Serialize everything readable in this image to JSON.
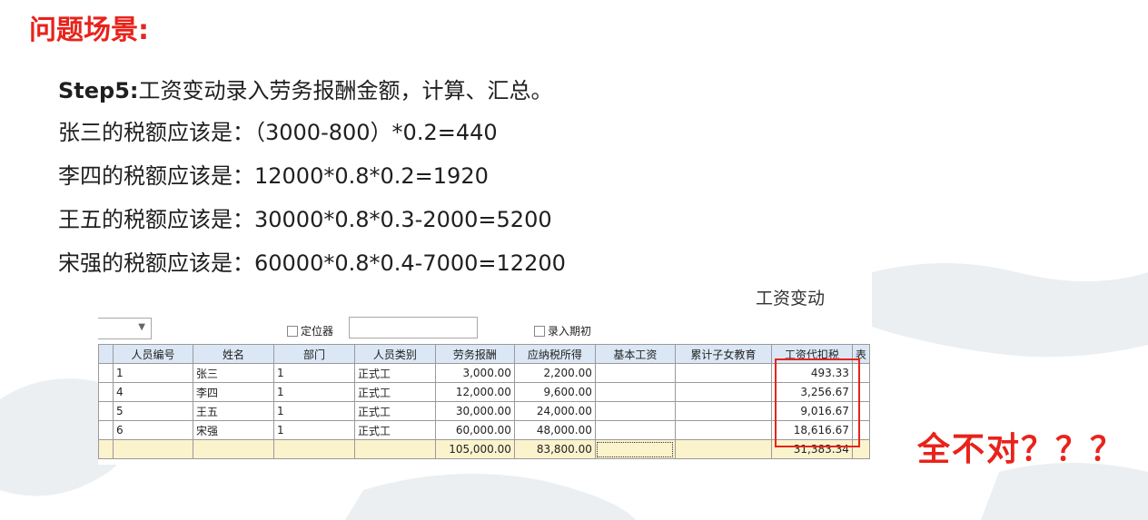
{
  "title": "问题场景:",
  "lines": {
    "step_label": "Step5:",
    "step_text": "工资变动录入劳务报酬金额，计算、汇总。",
    "zhangsan": "张三的税额应该是：（3000-800）*0.2=440",
    "lisi": "李四的税额应该是：12000*0.8*0.2=1920",
    "wangwu": "王五的税额应该是：30000*0.8*0.3-2000=5200",
    "songqiang": "宋强的税额应该是：60000*0.8*0.4-7000=12200"
  },
  "screenshot": {
    "window_title": "工资变动",
    "locator_label": "定位器",
    "locator_value": "",
    "entry_label": "录入期初",
    "headers": [
      "",
      "人员编号",
      "姓名",
      "部门",
      "人员类别",
      "劳务报酬",
      "应纳税所得",
      "基本工资",
      "累计子女教育",
      "工资代扣税",
      "表"
    ],
    "rows": [
      [
        "",
        "1",
        "张三",
        "1",
        "正式工",
        "3,000.00",
        "2,200.00",
        "",
        "",
        "493.33",
        ""
      ],
      [
        "",
        "4",
        "李四",
        "1",
        "正式工",
        "12,000.00",
        "9,600.00",
        "",
        "",
        "3,256.67",
        ""
      ],
      [
        "",
        "5",
        "王五",
        "1",
        "正式工",
        "30,000.00",
        "24,000.00",
        "",
        "",
        "9,016.67",
        ""
      ],
      [
        "",
        "6",
        "宋强",
        "1",
        "正式工",
        "60,000.00",
        "48,000.00",
        "",
        "",
        "18,616.67",
        ""
      ]
    ],
    "total": [
      "",
      "",
      "",
      "",
      "",
      "105,000.00",
      "83,800.00",
      "",
      "",
      "31,383.34",
      ""
    ]
  },
  "verdict": "全不对？？？"
}
